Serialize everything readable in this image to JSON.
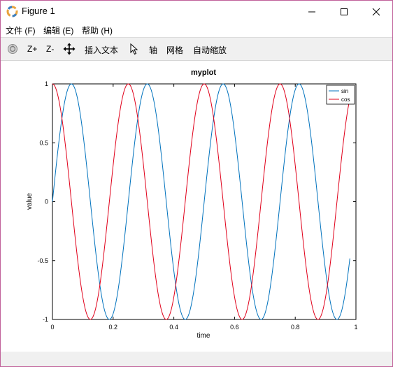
{
  "window": {
    "title": "Figure 1"
  },
  "menu": [
    {
      "label": "文件 (F)"
    },
    {
      "label": "编辑 (E)"
    },
    {
      "label": "帮助 (H)"
    }
  ],
  "toolbar": {
    "zoom_in": "Z+",
    "zoom_out": "Z-",
    "insert_text": "插入文本",
    "axes": "轴",
    "grid": "网格",
    "autoscale": "自动缩放"
  },
  "colors": {
    "sin": "#0072bd",
    "cos": "#e0001a"
  },
  "chart_data": {
    "type": "line",
    "title": "myplot",
    "xlabel": "time",
    "ylabel": "value",
    "xlim": [
      0,
      1
    ],
    "ylim": [
      -1,
      1
    ],
    "xticks": [
      "0",
      "0.2",
      "0.4",
      "0.6",
      "0.8",
      "1"
    ],
    "yticks": [
      "-1",
      "-0.5",
      "0",
      "0.5",
      "1"
    ],
    "grid": false,
    "legend": "top-right",
    "frequency": 4,
    "x_end": 0.98,
    "series": [
      {
        "name": "sin",
        "function": "sin(2*pi*4*t)"
      },
      {
        "name": "cos",
        "function": "cos(2*pi*4*t)"
      }
    ]
  }
}
